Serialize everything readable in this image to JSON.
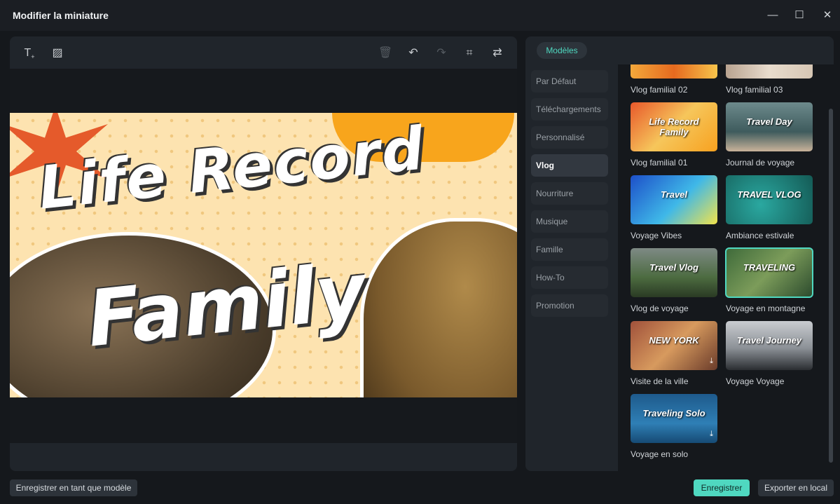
{
  "window": {
    "title": "Modifier la miniature",
    "controls": [
      "minimize",
      "maximize",
      "close"
    ]
  },
  "toolbar": {
    "tools": [
      {
        "name": "add-text",
        "glyph": "T₊"
      },
      {
        "name": "add-image",
        "glyph": "▨"
      },
      {
        "name": "delete",
        "glyph": "🗑"
      },
      {
        "name": "undo",
        "glyph": "↶"
      },
      {
        "name": "redo",
        "glyph": "↷"
      },
      {
        "name": "crop",
        "glyph": "⌗"
      },
      {
        "name": "replace",
        "glyph": "⇄"
      }
    ]
  },
  "canvas": {
    "line1": "Life Record",
    "line2": "Family"
  },
  "panel": {
    "tab": "Modèles",
    "categories": [
      "Par Défaut",
      "Téléchargements",
      "Personnalisé",
      "Vlog",
      "Nourriture",
      "Musique",
      "Famille",
      "How-To",
      "Promotion"
    ],
    "active_category": "Vlog",
    "templates": [
      {
        "label": "Vlog familial 02",
        "bg": "linear-gradient(90deg,#f3a83b,#e56a1f,#f7c44b)"
      },
      {
        "label": "Vlog familial 03",
        "bg": "linear-gradient(90deg,#b8a390,#e8dccd,#d6c6b4)"
      },
      {
        "label": "Vlog familial 01",
        "bg": "linear-gradient(135deg,#e8582b,#f6c65b 50%,#f7a11f)",
        "text": "Life Record Family"
      },
      {
        "label": "Journal de voyage",
        "bg": "linear-gradient(180deg,#6d8a8c,#3e5b5d 60%,#c9b39a)",
        "text": "Travel Day"
      },
      {
        "label": "Voyage Vibes",
        "bg": "linear-gradient(135deg,#1d4fc9,#3fb8e8 55%,#f2e34b)",
        "text": "Travel"
      },
      {
        "label": "Ambiance estivale",
        "bg": "radial-gradient(circle at 40% 60%,#2aa8a0,#145a55)",
        "text": "TRAVEL VLOG"
      },
      {
        "label": "Vlog de voyage",
        "bg": "linear-gradient(180deg,#7e8a85,#4c6b40 60%,#2a3a24)",
        "text": "Travel Vlog"
      },
      {
        "label": "Voyage en montagne",
        "bg": "linear-gradient(135deg,#3e6a3a,#7c9c5a 50%,#2b4a2d)",
        "text": "TRAVELING",
        "selected": true
      },
      {
        "label": "Visite de la ville",
        "bg": "linear-gradient(135deg,#a0513b,#d79a5e 50%,#6a3b2a)",
        "text": "NEW YORK"
      },
      {
        "label": "Voyage Voyage",
        "bg": "linear-gradient(180deg,#c9ccd0,#8c9197 55%,#2a2d31)",
        "text": "Travel Journey"
      },
      {
        "label": "Voyage en solo",
        "bg": "linear-gradient(180deg,#1e5a8c,#2f7fb5 60%,#164a74)",
        "text": "Traveling Solo"
      }
    ]
  },
  "footer": {
    "save_template": "Enregistrer en tant que modèle",
    "save": "Enregistrer",
    "export": "Exporter en local"
  },
  "colors": {
    "accent": "#4fd8c0",
    "panel": "#20252b",
    "background": "#15181c"
  }
}
